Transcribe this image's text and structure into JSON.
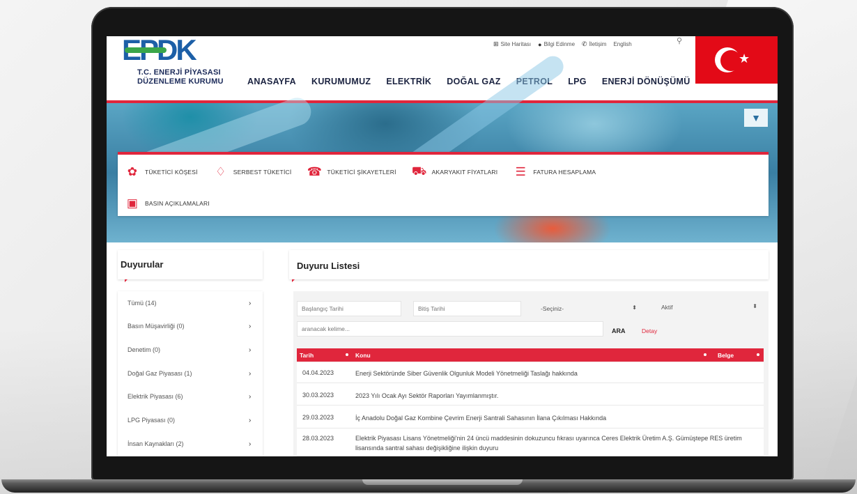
{
  "header": {
    "logo_mark": "EPDK",
    "logo_line1": "T.C. ENERJİ PİYASASI",
    "logo_line2": "DÜZENLEME KURUMU",
    "top_links": [
      {
        "icon": "sitemap-icon",
        "label": "Site Haritası"
      },
      {
        "icon": "info-icon",
        "label": "Bilgi Edinme"
      },
      {
        "icon": "phone-icon",
        "label": "İletişim"
      },
      {
        "icon": "",
        "label": "English"
      }
    ],
    "nav": [
      "ANASAYFA",
      "KURUMUMUZ",
      "ELEKTRİK",
      "DOĞAL GAZ",
      "PETROL",
      "LPG",
      "ENERJİ DÖNÜŞÜMÜ"
    ],
    "flag_star": "★"
  },
  "quick_links": [
    {
      "icon": "people-icon",
      "glyph": "👥",
      "label": "TÜKETİCİ KÖŞESİ"
    },
    {
      "icon": "lightbulb-icon",
      "glyph": "💡",
      "label": "SERBEST TÜKETİCİ"
    },
    {
      "icon": "complaint-icon",
      "glyph": "☎",
      "label": "TÜKETİCİ ŞİKAYETLERİ"
    },
    {
      "icon": "fuel-icon",
      "glyph": "⛽",
      "label": "AKARYAKIT FİYATLARI"
    },
    {
      "icon": "invoice-icon",
      "glyph": "🧾",
      "label": "FATURA HESAPLAMA"
    },
    {
      "icon": "tv-icon",
      "glyph": "📺",
      "label": "BASIN AÇIKLAMALARI"
    }
  ],
  "sidebar": {
    "title": "Duyurular",
    "items": [
      {
        "label": "Tümü (14)"
      },
      {
        "label": "Basın Müşavirliği (0)"
      },
      {
        "label": "Denetim (0)"
      },
      {
        "label": "Doğal Gaz Piyasası (1)"
      },
      {
        "label": "Elektrik Piyasası (6)"
      },
      {
        "label": "LPG Piyasası (0)"
      },
      {
        "label": "İnsan Kaynakları (2)"
      }
    ],
    "arrow": "›"
  },
  "main": {
    "title": "Duyuru Listesi",
    "filters": {
      "start_placeholder": "Başlangıç Tarihi",
      "end_placeholder": "Bitiş Tarihi",
      "category_value": "-Seçiniz-",
      "status_value": "Aktif",
      "search_placeholder": "aranacak kelime...",
      "search_button": "ARA",
      "detail_link": "Detay"
    },
    "table": {
      "headers": {
        "date": "Tarih",
        "subject": "Konu",
        "doc": "Belge"
      },
      "rows": [
        {
          "date": "04.04.2023",
          "subject": "Enerji Sektöründe Siber Güvenlik Olgunluk Modeli Yönetmeliği Taslağı hakkında"
        },
        {
          "date": "30.03.2023",
          "subject": "2023 Yılı Ocak Ayı Sektör Raporları Yayımlanmıştır."
        },
        {
          "date": "29.03.2023",
          "subject": "İç Anadolu Doğal Gaz Kombine Çevrim Enerji Santrali Sahasının İlana Çıkılması Hakkında"
        },
        {
          "date": "28.03.2023",
          "subject": "Elektrik Piyasası Lisans Yönetmeliği'nin 24 üncü maddesinin dokuzuncu fıkrası uyarınca Ceres Elektrik Üretim A.Ş. Gümüştepe RES üretim lisansında santral sahası değişikliğine ilişkin duyuru"
        }
      ]
    }
  },
  "colors": {
    "accent": "#e0263c",
    "brand": "#1c5fa7"
  }
}
